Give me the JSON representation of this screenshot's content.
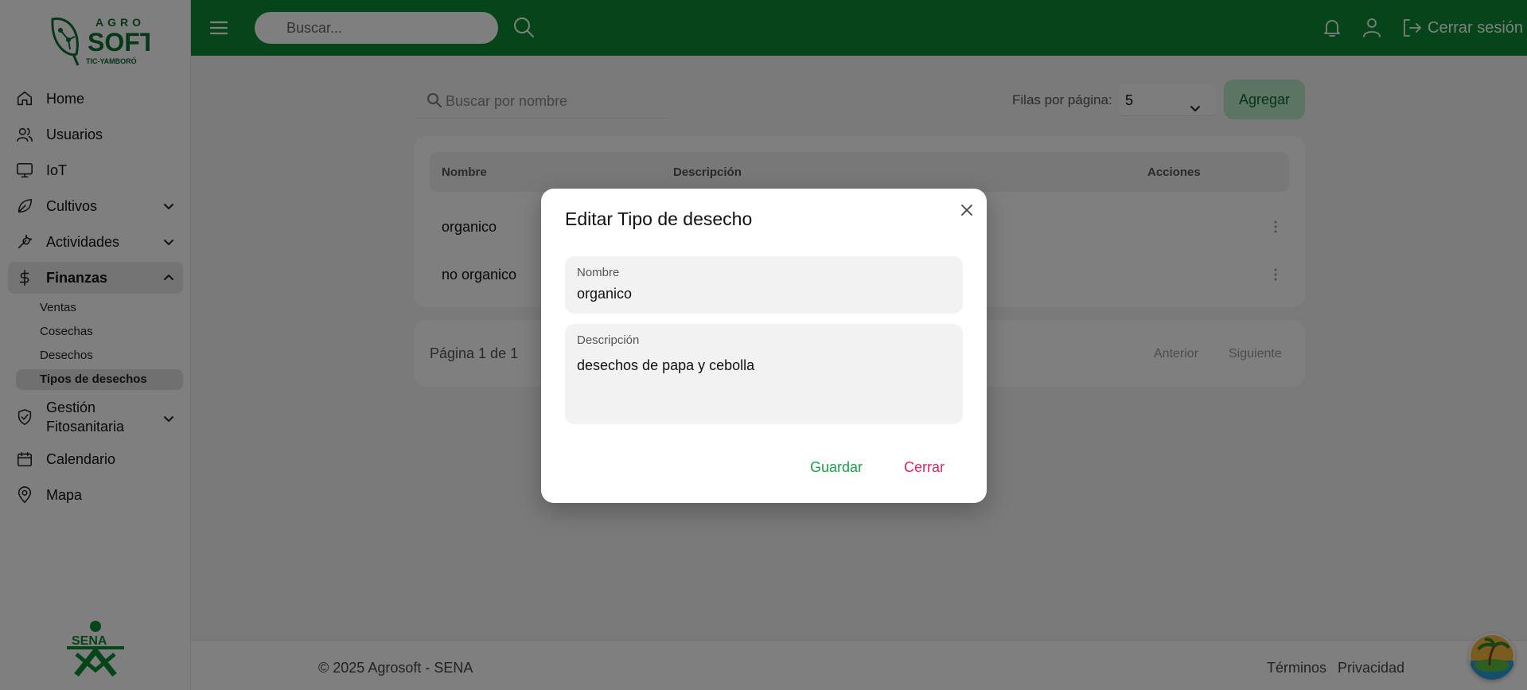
{
  "brand": {
    "logo_top": "AGRO",
    "logo_main": "SOFT",
    "logo_sub": "TIC-YAMBORÓ",
    "sena_text": "SENA",
    "primary_color": "#0d8a32"
  },
  "topbar": {
    "search_placeholder": "Buscar...",
    "logout_label": "Cerrar sesión"
  },
  "sidebar": {
    "items": [
      {
        "label": "Home",
        "icon": "home-icon"
      },
      {
        "label": "Usuarios",
        "icon": "users-icon"
      },
      {
        "label": "IoT",
        "icon": "monitor-icon"
      },
      {
        "label": "Cultivos",
        "icon": "leaf-icon"
      },
      {
        "label": "Actividades",
        "icon": "wrench-icon"
      },
      {
        "label": "Finanzas",
        "icon": "dollar-icon"
      },
      {
        "label": "Gestión\nFitosanitaria",
        "icon": "shield-check-icon"
      },
      {
        "label": "Calendario",
        "icon": "calendar-icon"
      },
      {
        "label": "Mapa",
        "icon": "map-pin-icon"
      }
    ],
    "finanzas_sub": [
      "Ventas",
      "Cosechas",
      "Desechos",
      "Tipos de desechos"
    ]
  },
  "toolbar": {
    "search_placeholder": "Buscar por nombre",
    "rows_label": "Filas por página:",
    "rows_value": "5",
    "add_label": "Agregar"
  },
  "table": {
    "headers": [
      "Nombre",
      "Descripción",
      "Acciones"
    ],
    "rows": [
      {
        "nombre": "organico"
      },
      {
        "nombre": "no organico"
      }
    ]
  },
  "pager": {
    "info": "Página 1 de 1",
    "prev": "Anterior",
    "next": "Siguiente"
  },
  "footer": {
    "copy": "© 2025 Agrosoft - SENA",
    "terms": "Términos",
    "privacy": "Privacidad"
  },
  "modal": {
    "title": "Editar Tipo de desecho",
    "nombre_label": "Nombre",
    "nombre_value": "organico",
    "descripcion_label": "Descripción",
    "descripcion_value": "desechos de papa y cebolla",
    "save_label": "Guardar",
    "close_label": "Cerrar"
  }
}
